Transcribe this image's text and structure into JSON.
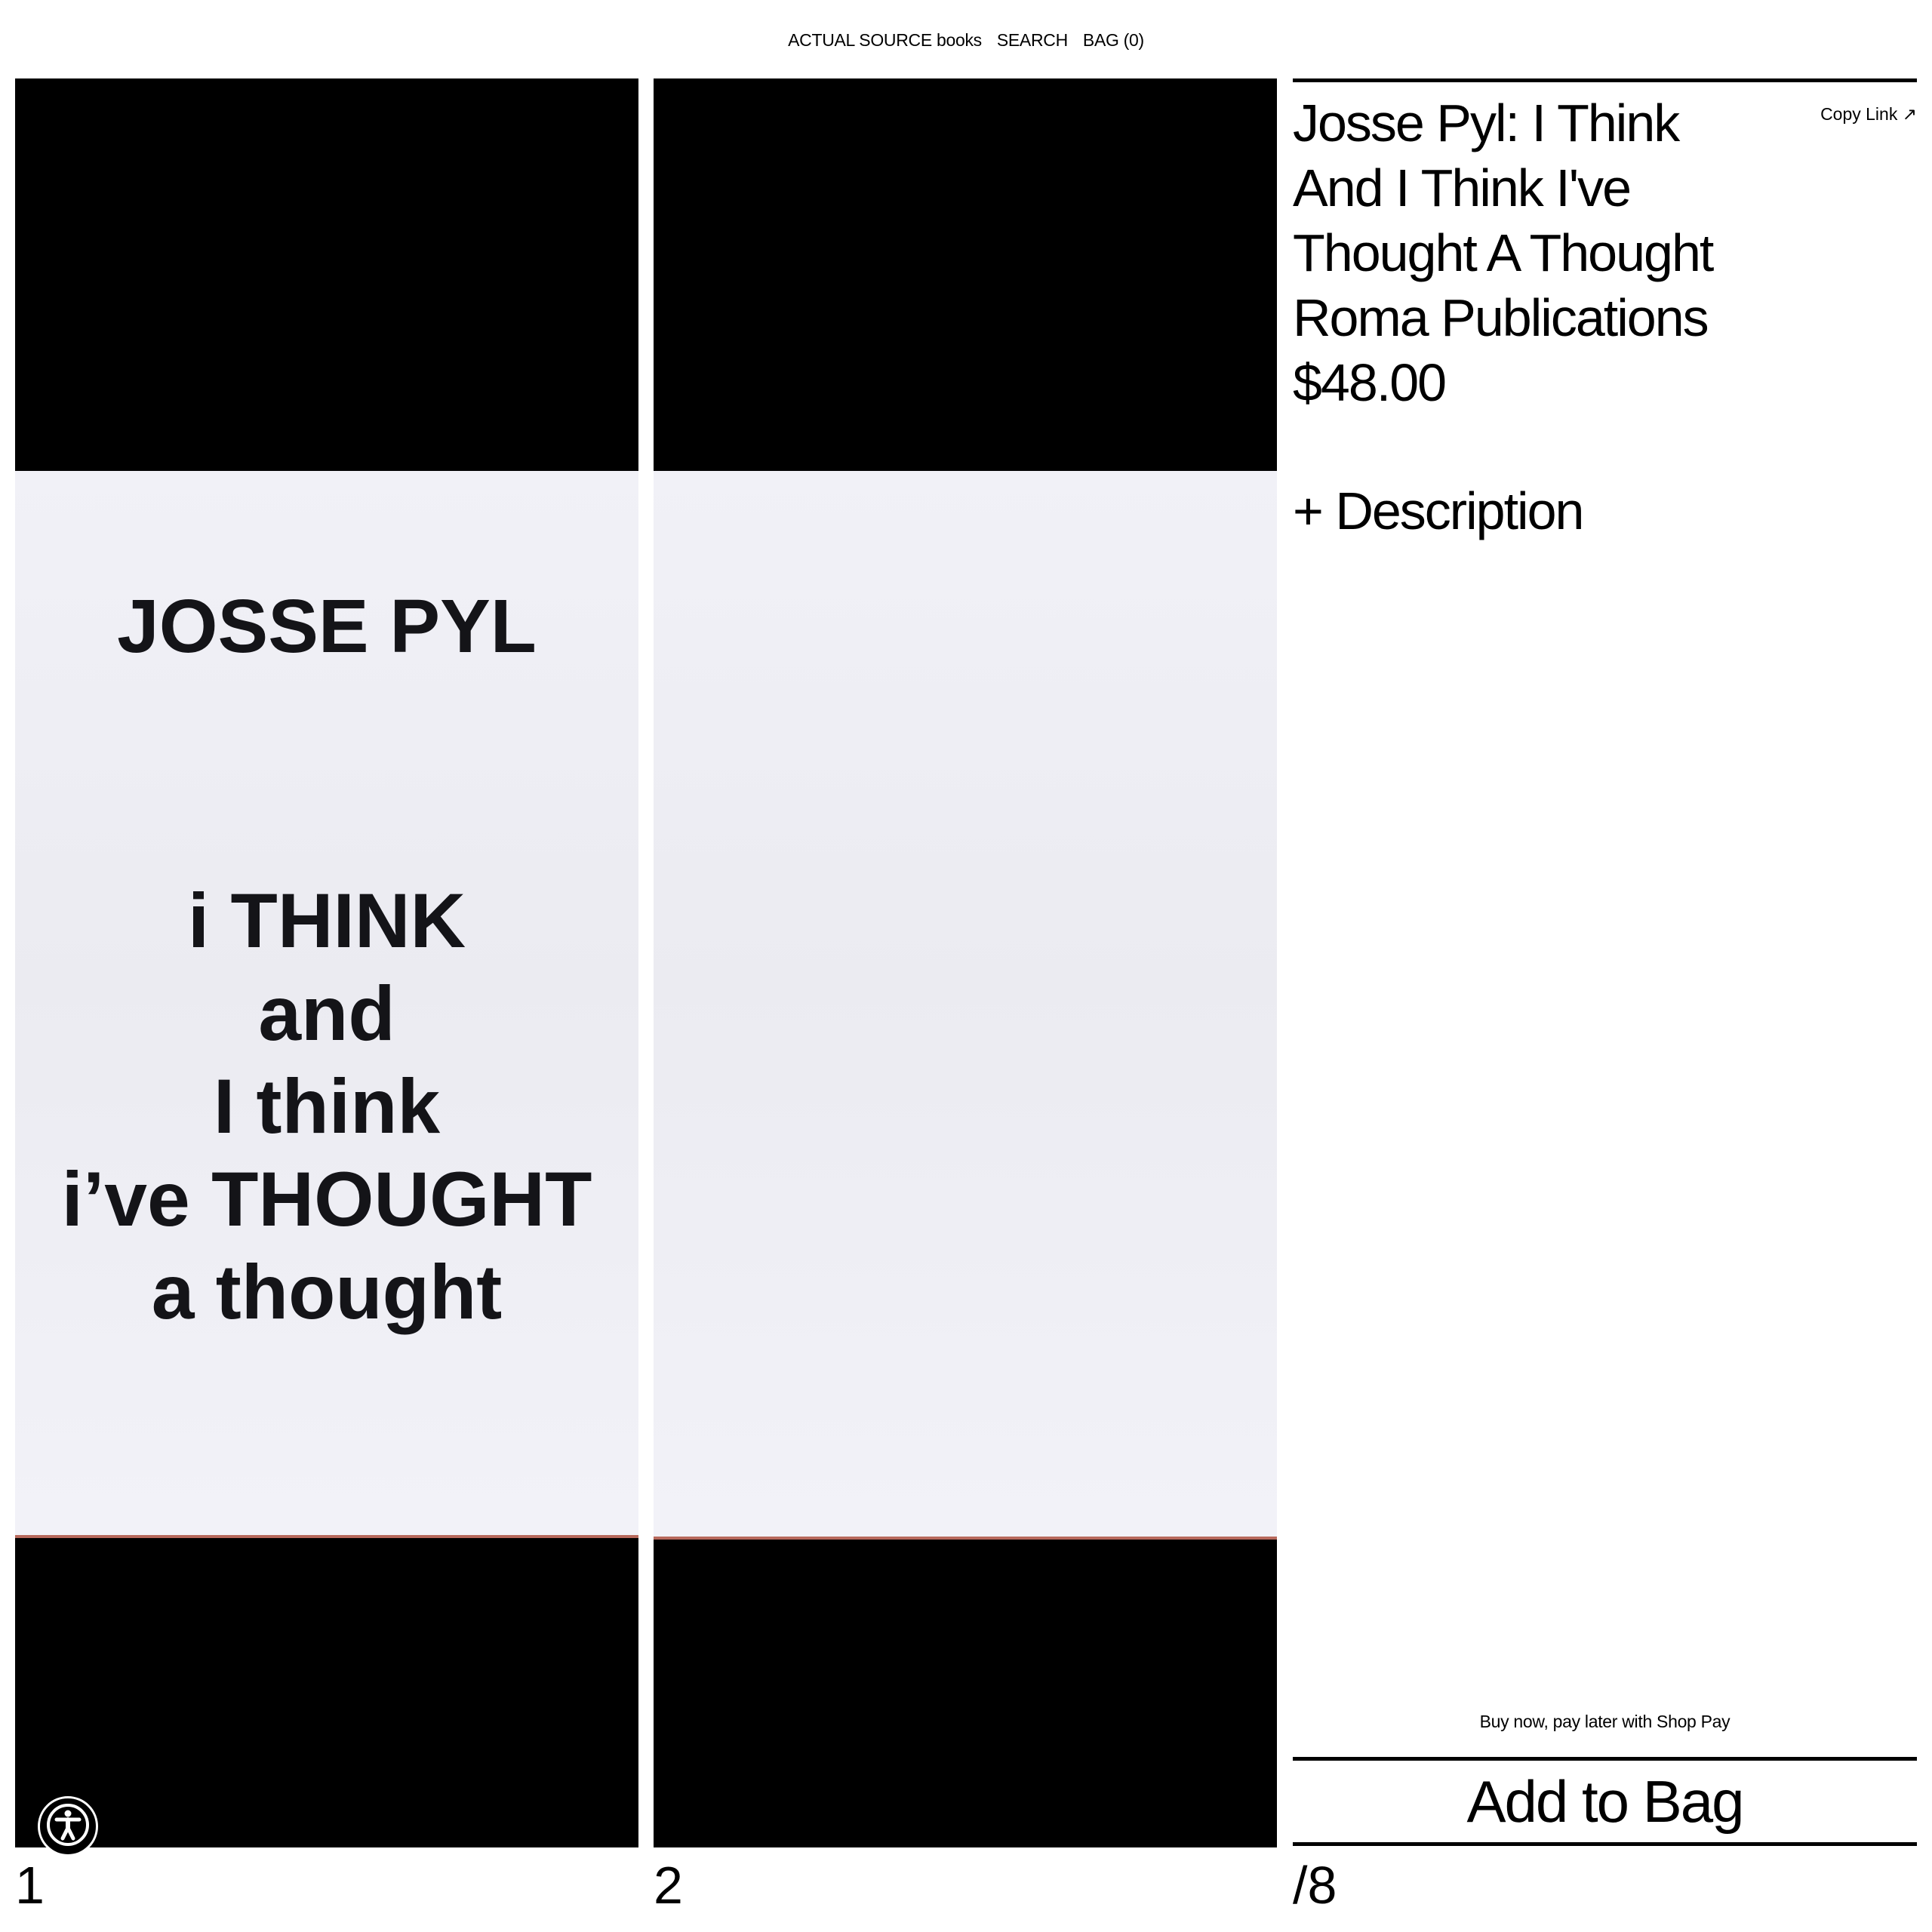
{
  "nav": {
    "store_name": "ACTUAL SOURCE books",
    "search": "SEARCH",
    "bag": "BAG (0)"
  },
  "gallery": {
    "cover": {
      "author": "JOSSE PYL",
      "title_lines": [
        "i THINK",
        "and",
        "I think",
        "i’ve THOUGHT",
        "a thought"
      ]
    },
    "slide_numbers": [
      "1",
      "2"
    ],
    "total": "/8"
  },
  "product": {
    "title_lines": [
      "Josse Pyl: I Think",
      "And I Think I've",
      "Thought A Thought"
    ],
    "publisher": "Roma Publications",
    "price": "$48.00",
    "copy_link": "Copy Link ↗",
    "description_toggle": "+ Description",
    "shop_pay": "Buy now, pay later with Shop Pay",
    "add_to_bag": "Add to Bag"
  },
  "icons": {
    "accessibility": "accessibility-icon"
  },
  "colors": {
    "background": "#ffffff",
    "text": "#000000",
    "panel": "#000000",
    "page_paper": "#eeeef4"
  }
}
